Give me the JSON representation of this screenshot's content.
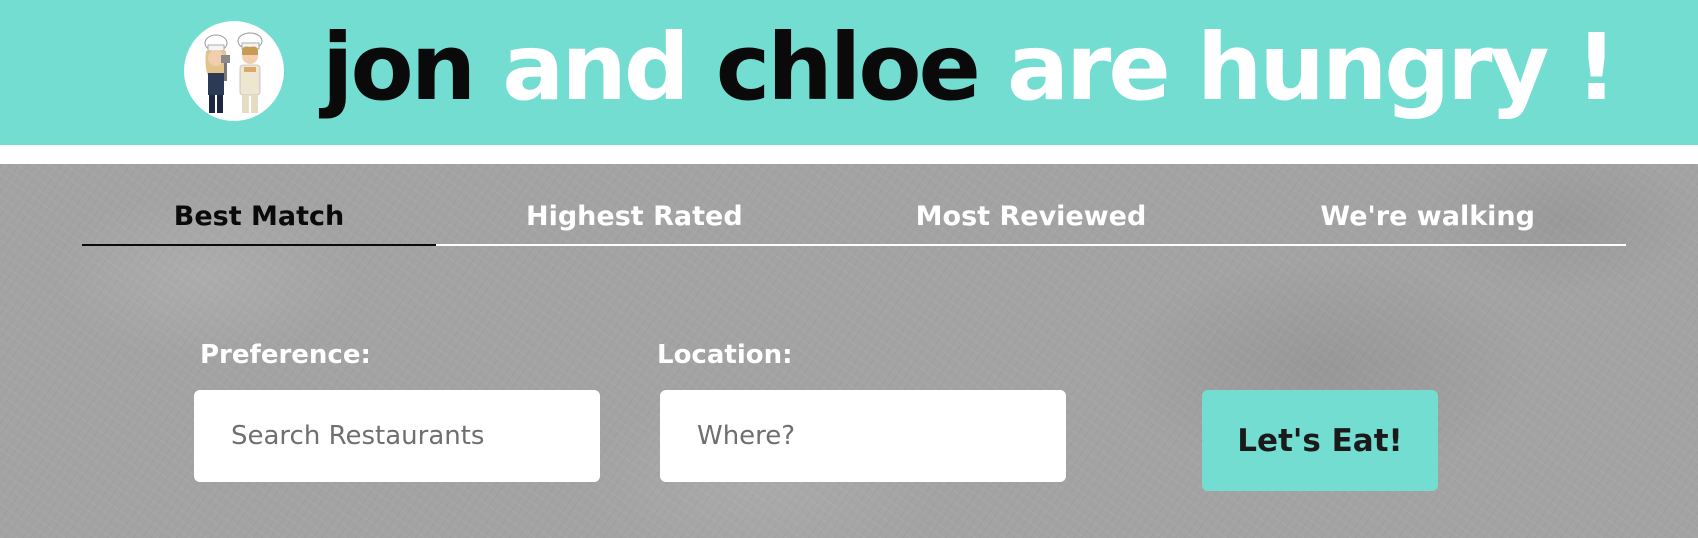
{
  "header": {
    "title_parts": {
      "name1": "jon",
      "and": "and",
      "name2": "chloe",
      "rest": "are hungry !"
    },
    "avatar_icon": "chefs-avatar-icon"
  },
  "tabs": [
    {
      "label": "Best Match",
      "active": true
    },
    {
      "label": "Highest Rated",
      "active": false
    },
    {
      "label": "Most Reviewed",
      "active": false
    },
    {
      "label": "We're walking",
      "active": false
    }
  ],
  "form": {
    "preference_label": "Preference:",
    "preference_placeholder": "Search Restaurants",
    "preference_value": "",
    "location_label": "Location:",
    "location_placeholder": "Where?",
    "location_value": "",
    "submit_label": "Let's Eat!"
  },
  "colors": {
    "accent": "#72ddd0",
    "background": "#a3a3a3",
    "title_dark": "#0a0a0a",
    "title_light": "#ffffff"
  }
}
